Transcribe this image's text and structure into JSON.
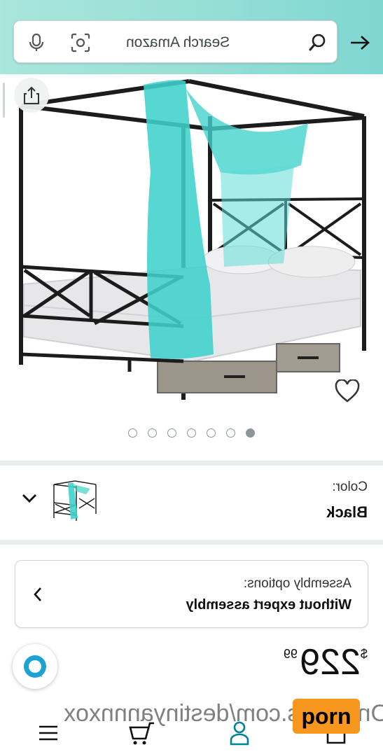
{
  "search": {
    "placeholder": "Search Amazon",
    "icons": [
      "search-icon",
      "camera-scan-icon",
      "microphone-icon",
      "arrow-right-icon"
    ]
  },
  "gallery": {
    "image_count": 7,
    "active_index": 6,
    "icons": [
      "share-icon",
      "heart-icon"
    ]
  },
  "color": {
    "label": "Color:",
    "value": "Black"
  },
  "assembly": {
    "label": "Assembly options:",
    "value": "Without expert assembly"
  },
  "price": {
    "currency": "$",
    "whole": "229",
    "fraction": "99"
  },
  "overlay": {
    "watermark": "OnlyFans.com/destinyannnxox",
    "badge": "porn"
  },
  "colors": {
    "header_gradient_start": "#a9e6dc",
    "header_gradient_end": "#7fd7d2",
    "accent_teal": "#008296",
    "divider": "#eaeded",
    "badge": "#f7971d"
  }
}
